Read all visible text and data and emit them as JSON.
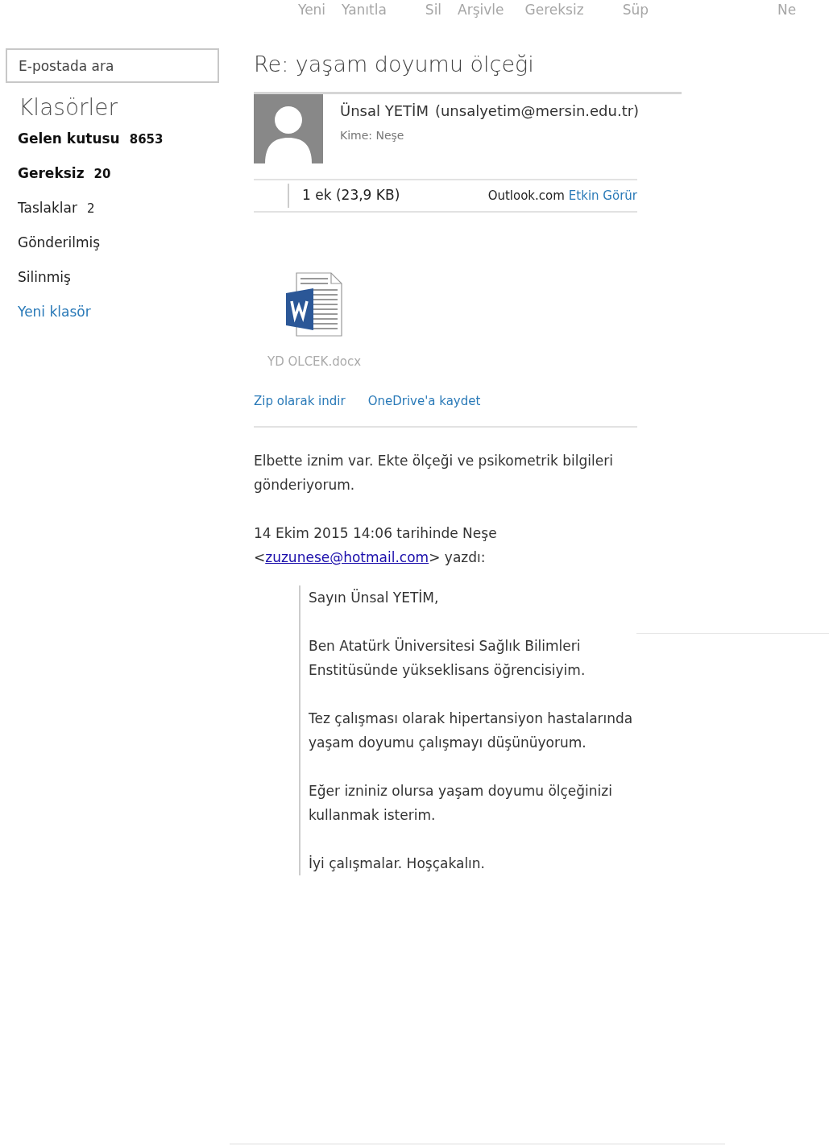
{
  "toolbar": [
    {
      "label": "Yeni"
    },
    {
      "label": "Yanıtla"
    },
    {
      "label": "Sil"
    },
    {
      "label": "Arşivle"
    },
    {
      "label": "Gereksiz"
    },
    {
      "label": "Süp"
    },
    {
      "label": "Ne"
    }
  ],
  "search": {
    "placeholder": "E-postada ara"
  },
  "sidebar": {
    "heading": "Klasörler",
    "items": [
      {
        "kind": "folder",
        "label": "Gelen kutusu",
        "count": "8653",
        "unread": true
      },
      {
        "kind": "folder",
        "label": "Gereksiz",
        "count": "20",
        "unread": true
      },
      {
        "kind": "folder",
        "label": "Taslaklar",
        "count": "2",
        "unread": false
      },
      {
        "kind": "folder",
        "label": "Gönderilmiş",
        "unread": false
      },
      {
        "kind": "folder",
        "label": "Silinmiş",
        "unread": false
      },
      {
        "kind": "link",
        "label": "Yeni klasör"
      }
    ]
  },
  "message": {
    "subject": "Re: yaşam doyumu ölçeği",
    "sender": "Ünsal YETİM",
    "sender_email": "(unsalyetim@mersin.edu.tr)",
    "to": "Kime: Neşe",
    "attachments_summary": "1 ek (23,9 KB)",
    "viewer_prefix": "Outlook.com",
    "viewer_link": "Etkin Görür",
    "attachment": {
      "name": "YD OLCEK.docx"
    },
    "actions": [
      "Zip olarak indir",
      "OneDrive'a kaydet"
    ],
    "body": [
      "Elbette iznim var. Ekte ölçeği ve psikometrik bilgileri gönderiyorum."
    ],
    "quote_intro": "14 Ekim 2015 14:06 tarihinde Neşe",
    "quote_email": "zuzunese@hotmail.com",
    "quote_prefix": "<",
    "quote_suffix": "> yazdı:",
    "quoted": [
      "Sayın Ünsal YETİM,",
      "Ben Atatürk Üniversitesi Sağlık Bilimleri Enstitüsünde yükseklisans öğrencisiyim.",
      "Tez çalışması olarak hipertansiyon hastalarında yaşam doyumu çalışmayı düşünüyorum.",
      "Eğer izniniz olursa yaşam doyumu ölçeğinizi kullanmak isterim.",
      "İyi çalışmalar. Hoşçakalın."
    ]
  }
}
